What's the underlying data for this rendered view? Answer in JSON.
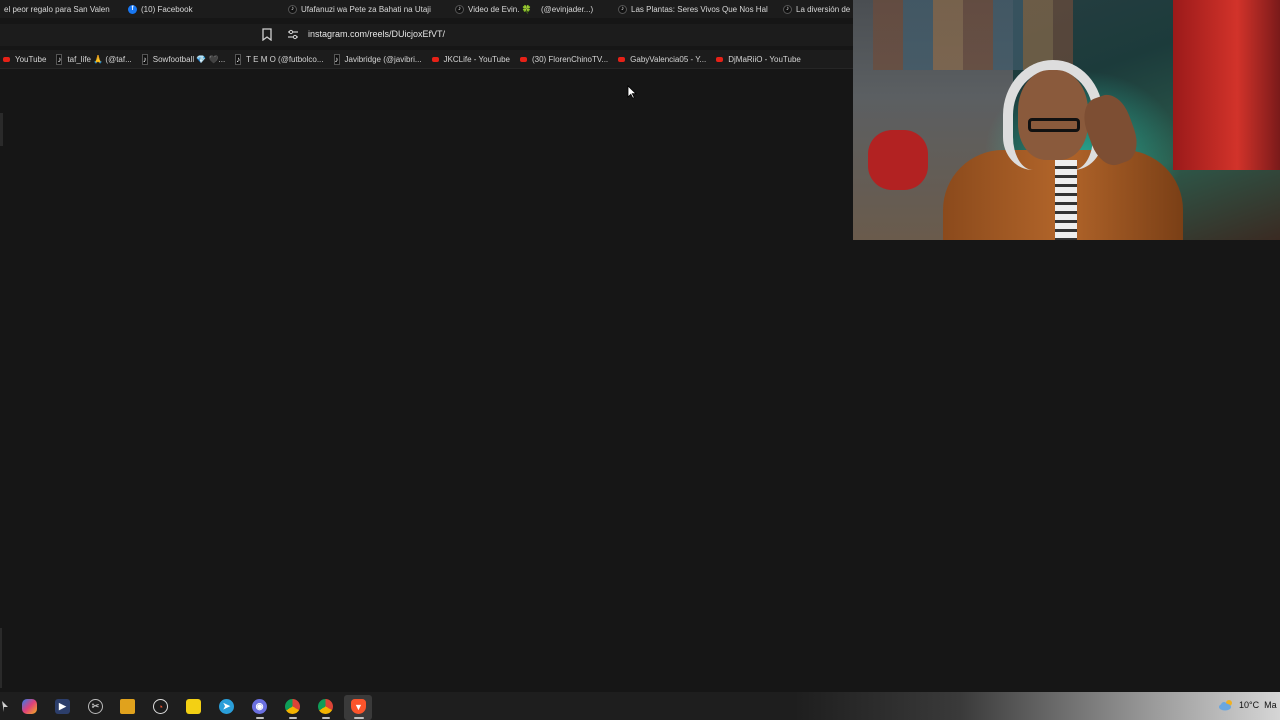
{
  "browser": {
    "tabs": [
      {
        "label": "el peor regalo para San Valen",
        "icon": "none"
      },
      {
        "label": "(10) Facebook",
        "icon": "facebook-icon"
      },
      {
        "label": "Ufafanuzi wa Pete za Bahati na Utaji",
        "icon": "tiktok-icon"
      },
      {
        "label": "Video de Evin. 🍀",
        "icon": "tiktok-icon"
      },
      {
        "label": "(@evinjader...)",
        "icon": "none"
      },
      {
        "label": "Las Plantas: Seres Vivos Que Nos Hal",
        "icon": "tiktok-icon"
      },
      {
        "label": "La diversión de",
        "icon": "tiktok-icon"
      }
    ],
    "url": "instagram.com/reels/DUicjoxEfVT/",
    "bookmarks": [
      {
        "label": "YouTube",
        "icon": "youtube-icon"
      },
      {
        "label": "taf_life 🙏 (@taf...",
        "icon": "tiktok-icon"
      },
      {
        "label": "Sowfootball 💎 🖤...",
        "icon": "tiktok-icon"
      },
      {
        "label": "T E M O (@futbolco...",
        "icon": "tiktok-icon"
      },
      {
        "label": "Javibridge (@javibri...",
        "icon": "tiktok-icon"
      },
      {
        "label": "JKCLife - YouTube",
        "icon": "youtube-icon"
      },
      {
        "label": "(30) FlorenChinoTV...",
        "icon": "youtube-icon"
      },
      {
        "label": "GabyValencia05 - Y...",
        "icon": "youtube-icon"
      },
      {
        "label": "DjMaRiiO - YouTube",
        "icon": "youtube-icon"
      }
    ]
  },
  "taskbar": {
    "icons": [
      "start-icon",
      "copilot-icon",
      "media-player-icon",
      "snipping-tool-icon",
      "file-explorer-icon",
      "speedtest-icon",
      "sticky-notes-icon",
      "telegram-icon",
      "discord-icon",
      "chrome-icon",
      "chrome-icon-2",
      "brave-icon"
    ],
    "weather": {
      "temp": "10°C",
      "label": "Ma"
    }
  },
  "colors": {
    "background": "#161616",
    "chrome": "#1c1c1c",
    "youtube": "#e62117",
    "facebook": "#1877f2",
    "brave": "#fb542b"
  }
}
